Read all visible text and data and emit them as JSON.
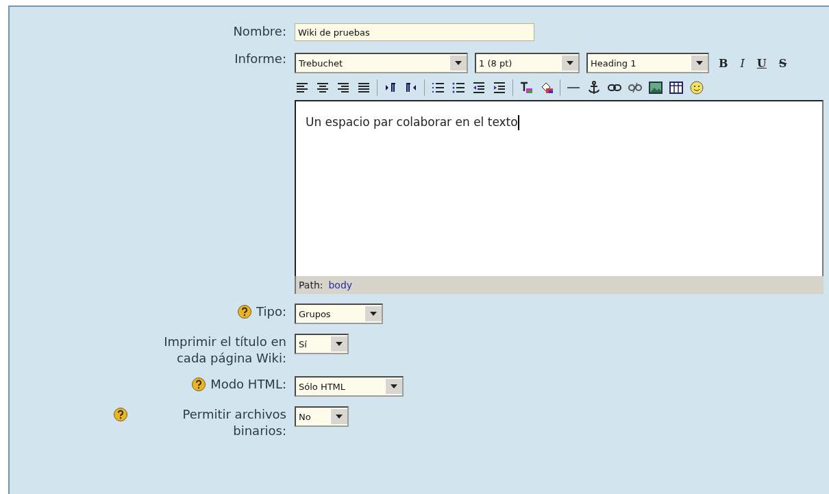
{
  "form": {
    "fields": [
      {
        "kind": "text",
        "label": "Nombre:",
        "help": false,
        "value": "Wiki de pruebas"
      },
      {
        "kind": "editor",
        "label": "Informe:",
        "help": false,
        "font": "Trebuchet",
        "size": "1 (8 pt)",
        "format": "Heading 1",
        "styles": [
          {
            "kind": "bold",
            "text": "B"
          },
          {
            "kind": "italic",
            "text": "I"
          },
          {
            "kind": "underline",
            "text": "U"
          },
          {
            "kind": "strike",
            "text": "S"
          }
        ],
        "content": "Un espacio par colaborar en el texto",
        "path_label": "Path:",
        "path_value": "body"
      },
      {
        "kind": "select",
        "label": "Tipo:",
        "help": true,
        "value": "Grupos"
      },
      {
        "kind": "select",
        "label": "Imprimir el título en cada página Wiki:",
        "help": false,
        "value": "Sí"
      },
      {
        "kind": "select",
        "label": "Modo HTML:",
        "help": true,
        "value": "Sólo HTML"
      },
      {
        "kind": "select",
        "label": "Permitir archivos binarios:",
        "help": true,
        "value": "No"
      }
    ]
  }
}
